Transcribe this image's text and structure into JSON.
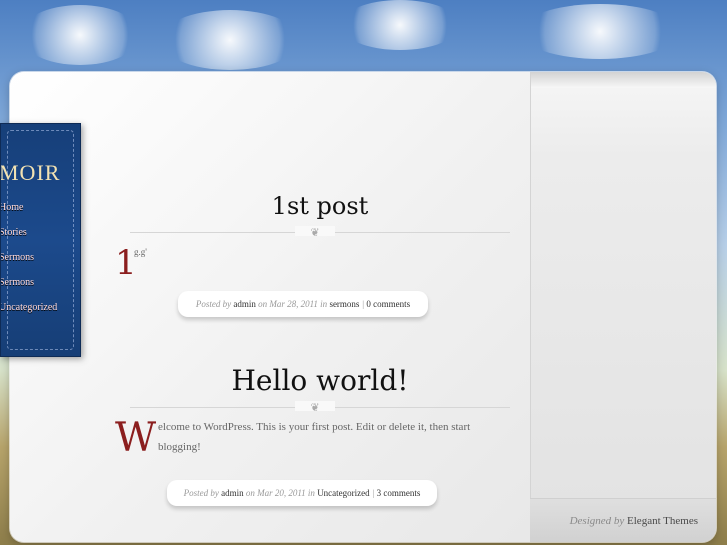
{
  "site": {
    "logo": "MOIR",
    "nav": [
      "Home",
      "Stories",
      "Sermons",
      "Sermons",
      "Uncategorized"
    ]
  },
  "post1": {
    "title": "1st post",
    "dropcap": "1",
    "text": "g.g'",
    "meta": {
      "posted_by_label": "Posted by",
      "author": "admin",
      "on_label": "on",
      "date": "Mar 28, 2011",
      "in_label": "in",
      "category": "sermons",
      "sep": "|",
      "comments": "0 comments"
    }
  },
  "post2": {
    "title": "Hello world!",
    "dropcap": "W",
    "text": "elcome to WordPress. This is your first post. Edit or delete it, then start blogging!",
    "meta": {
      "posted_by_label": "Posted by",
      "author": "admin",
      "on_label": "on",
      "date": "Mar 20, 2011",
      "in_label": "in",
      "category": "Uncategorized",
      "sep": "|",
      "comments": "3 comments"
    }
  },
  "footer": {
    "designed_by": "Designed by",
    "brand": "Elegant Themes"
  }
}
